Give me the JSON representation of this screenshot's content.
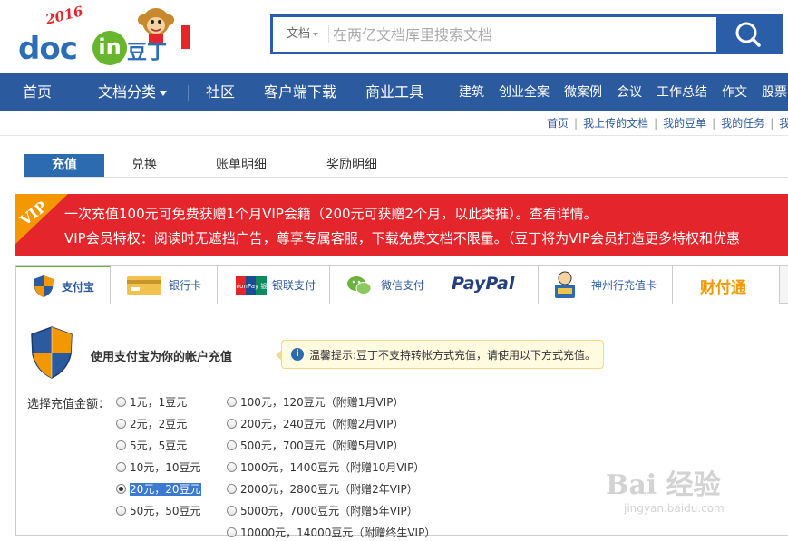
{
  "logo": {
    "year": "2016",
    "brand": "doc",
    "brand_in": "in",
    "brand_cn": "豆丁"
  },
  "search": {
    "scope": "文档",
    "placeholder": "在两亿文档库里搜索文档"
  },
  "nav": {
    "home": "首页",
    "categories": "文档分类",
    "community": "社区",
    "client_download": "客户端下载",
    "business_tools": "商业工具",
    "links": [
      "建筑",
      "创业全案",
      "微案例",
      "会议",
      "工作总结",
      "作文",
      "股票"
    ]
  },
  "user_links": [
    "首页",
    "我上传的文档",
    "我的豆单",
    "我的任务",
    "我"
  ],
  "tabs": [
    "充值",
    "兑换",
    "账单明细",
    "奖励明细"
  ],
  "vip": {
    "corner": "VIP",
    "line1": "一次充值100元可免费获赠1个月VIP会籍（200元可获赠2个月，以此类推）。查看详情。",
    "line2": "VIP会员特权：阅读时无遮挡广告，尊享专属客服，下载免费文档不限量。（豆丁将为VIP会员打造更多特权和优惠"
  },
  "pay_tabs": [
    "支付宝",
    "银行卡",
    "银联支付",
    "微信支付",
    "PayPal",
    "神州行充值卡",
    "财付通"
  ],
  "pay_tab_icon_text": {
    "unionpay": "UnionPay 银联",
    "tenpay": "财付通"
  },
  "alipay": {
    "title": "使用支付宝为你的帐户充值",
    "notice": "温馨提示:豆丁不支持转帐方式充值，请使用以下方式充值。",
    "amount_label": "选择充值金额：",
    "options_left": [
      "1元，1豆元",
      "2元，2豆元",
      "5元，5豆元",
      "10元，10豆元",
      "20元，20豆元",
      "50元，50豆元"
    ],
    "options_right": [
      "100元，120豆元（附赠1月VIP）",
      "200元，240豆元（附赠2月VIP）",
      "500元，700豆元（附赠5月VIP）",
      "1000元，1400豆元（附赠10月VIP）",
      "2000元，2800豆元（附赠2年VIP）",
      "5000元，7000豆元（附赠5年VIP）",
      "10000元，14000豆元（附赠终生VIP）"
    ],
    "selected": "20元，20豆元"
  },
  "watermark": {
    "brand": "Bai 经验",
    "url": "jingyan.baidu.com"
  },
  "colors": {
    "nav_blue": "#2c5a9f",
    "vip_red": "#e4252b",
    "vip_orange": "#f39800",
    "active_tab": "#2c6bb0"
  }
}
